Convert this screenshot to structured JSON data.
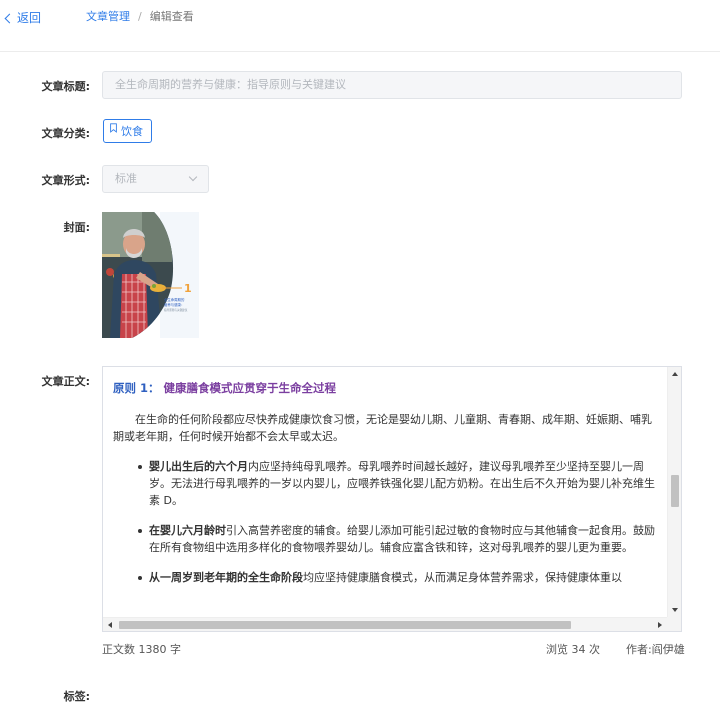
{
  "header": {
    "back_label": "返回",
    "breadcrumb": [
      "文章管理",
      "编辑查看"
    ],
    "breadcrumb_sep": "/"
  },
  "form": {
    "title_label": "文章标题:",
    "title_value": "全生命周期的营养与健康：指导原则与关键建议",
    "category_label": "文章分类:",
    "category_value": "饮食",
    "format_label": "文章形式:",
    "format_value": "标准",
    "cover_label": "封面:",
    "body_label": "文章正文:",
    "tags_label": "标签:"
  },
  "cover_image": {
    "badge_number": "1",
    "badge_lines": [
      "全生命周期的",
      "营养与健康：",
      "指导原则与关键建议"
    ],
    "colors": {
      "blue": "#4a8cc9",
      "orange": "#f0a23b"
    }
  },
  "article": {
    "heading_prefix": "原则 1：",
    "heading_text": "健康膳食模式应贯穿于生命全过程",
    "intro": "在生命的任何阶段都应尽快养成健康饮食习惯，无论是婴幼儿期、儿童期、青春期、成年期、妊娠期、哺乳期或老年期，任何时候开始都不会太早或太迟。",
    "bullets": [
      {
        "bold": "婴儿出生后的六个月",
        "text": "内应坚持纯母乳喂养。母乳喂养时间越长越好，建议母乳喂养至少坚持至婴儿一周岁。无法进行母乳喂养的一岁以内婴儿，应喂养铁强化婴儿配方奶粉。在出生后不久开始为婴儿补充维生素 D。"
      },
      {
        "bold": "在婴儿六月龄时",
        "text": "引入高营养密度的辅食。给婴儿添加可能引起过敏的食物时应与其他辅食一起食用。鼓励在所有食物组中选用多样化的食物喂养婴幼儿。辅食应富含铁和锌，这对母乳喂养的婴儿更为重要。"
      },
      {
        "bold": "从一周岁到老年期的全生命阶段",
        "text": "均应坚持健康膳食模式，从而满足身体营养需求，保持健康体重以"
      }
    ]
  },
  "footer": {
    "word_count": "正文数 1380 字",
    "views": "浏览 34 次",
    "author": "作者:阎伊雄"
  },
  "colors": {
    "accent": "#2f7ce8",
    "heading_purple": "#7b3fa0",
    "heading_blue": "#2f60c0"
  }
}
